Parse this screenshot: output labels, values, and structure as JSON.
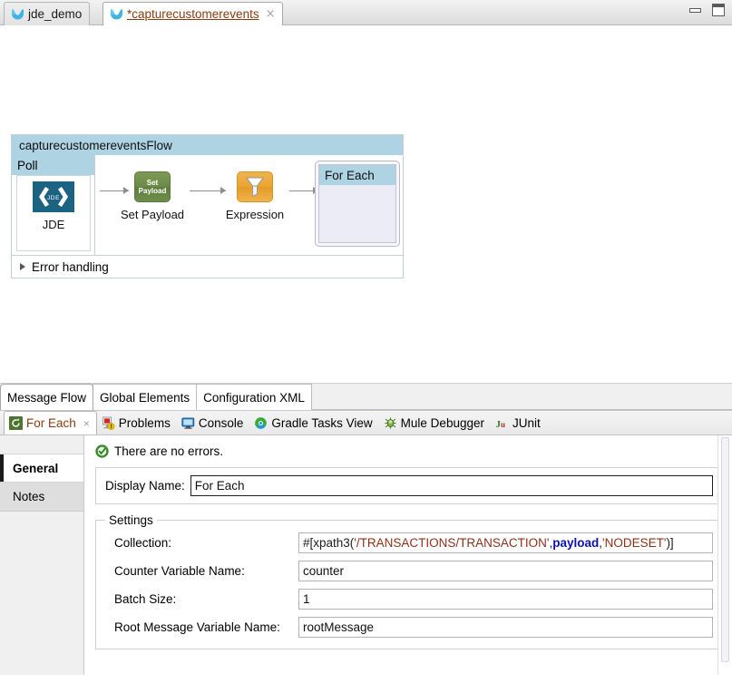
{
  "window": {
    "minimize_label": "Minimize",
    "maximize_label": "Maximize"
  },
  "editor_tabs": [
    {
      "label": "jde_demo",
      "icon": "mule-icon",
      "active": false,
      "closable": false
    },
    {
      "label": "*capturecustomerevents",
      "icon": "mule-icon",
      "active": true,
      "closable": true,
      "close_glyph": "×"
    }
  ],
  "canvas": {
    "flow": {
      "name": "capturecustomereventsFlow",
      "source": {
        "header": "Poll",
        "icon": "jde-icon",
        "icon_text": "JDE",
        "label": "JDE"
      },
      "processors": [
        {
          "label": "Set Payload",
          "icon": "set-payload-icon",
          "icon_text_line1": "Set",
          "icon_text_line2": "Payload",
          "color": "#6d8b48"
        },
        {
          "label": "Expression",
          "icon": "expression-filter-icon",
          "color": "#eaa531"
        }
      ],
      "scope": {
        "header": "For Each"
      },
      "error_handling": {
        "label": "Error handling",
        "expanded": false,
        "chevron": "collapsed-triangle-icon"
      }
    }
  },
  "editor_subtabs": [
    {
      "label": "Message Flow",
      "active": true
    },
    {
      "label": "Global Elements",
      "active": false
    },
    {
      "label": "Configuration XML",
      "active": false
    }
  ],
  "view_tabs": [
    {
      "label": "For Each",
      "icon": "foreach-loop-icon",
      "active": true,
      "closable": true,
      "close_glyph": "×"
    },
    {
      "label": "Problems",
      "icon": "problems-icon",
      "active": false,
      "closable": false
    },
    {
      "label": "Console",
      "icon": "console-icon",
      "active": false,
      "closable": false
    },
    {
      "label": "Gradle Tasks View",
      "icon": "gradle-icon",
      "active": false,
      "closable": false
    },
    {
      "label": "Mule Debugger",
      "icon": "mule-debugger-icon",
      "active": false,
      "closable": false
    },
    {
      "label": "JUnit",
      "icon": "junit-icon",
      "icon_text": "Ju",
      "active": false,
      "closable": false
    }
  ],
  "properties": {
    "side_tabs": [
      {
        "label": "General",
        "active": true
      },
      {
        "label": "Notes",
        "active": false
      }
    ],
    "status": {
      "icon": "success-check-icon",
      "text": "There are no errors."
    },
    "display_name": {
      "label": "Display Name:",
      "value": "For Each"
    },
    "settings": {
      "legend": "Settings",
      "fields": [
        {
          "label": "Collection:",
          "value": "#[xpath3('/TRANSACTIONS/TRANSACTION',payload,'NODESET')]",
          "segments": [
            {
              "text": "#[xpath3(",
              "kind": "base"
            },
            {
              "text": "'/TRANSACTIONS/TRANSACTION'",
              "kind": "string"
            },
            {
              "text": ",",
              "kind": "base"
            },
            {
              "text": "payload",
              "kind": "keyword"
            },
            {
              "text": ",",
              "kind": "base"
            },
            {
              "text": "'NODESET'",
              "kind": "string"
            },
            {
              "text": ")]",
              "kind": "base"
            }
          ]
        },
        {
          "label": "Counter Variable Name:",
          "value": "counter"
        },
        {
          "label": "Batch Size:",
          "value": "1"
        },
        {
          "label": "Root Message Variable Name:",
          "value": "rootMessage"
        }
      ]
    }
  },
  "colors": {
    "flow_header": "#aed3e3",
    "jde_icon": "#1c6382",
    "set_payload": "#6d8b48",
    "expression": "#eaa531",
    "foreach_body": "#ececf6",
    "active_tab_text": "#8a3b0f",
    "expression_string": "#8f2f18",
    "expression_keyword": "#0a11b8",
    "success_green": "#3fa02c"
  }
}
